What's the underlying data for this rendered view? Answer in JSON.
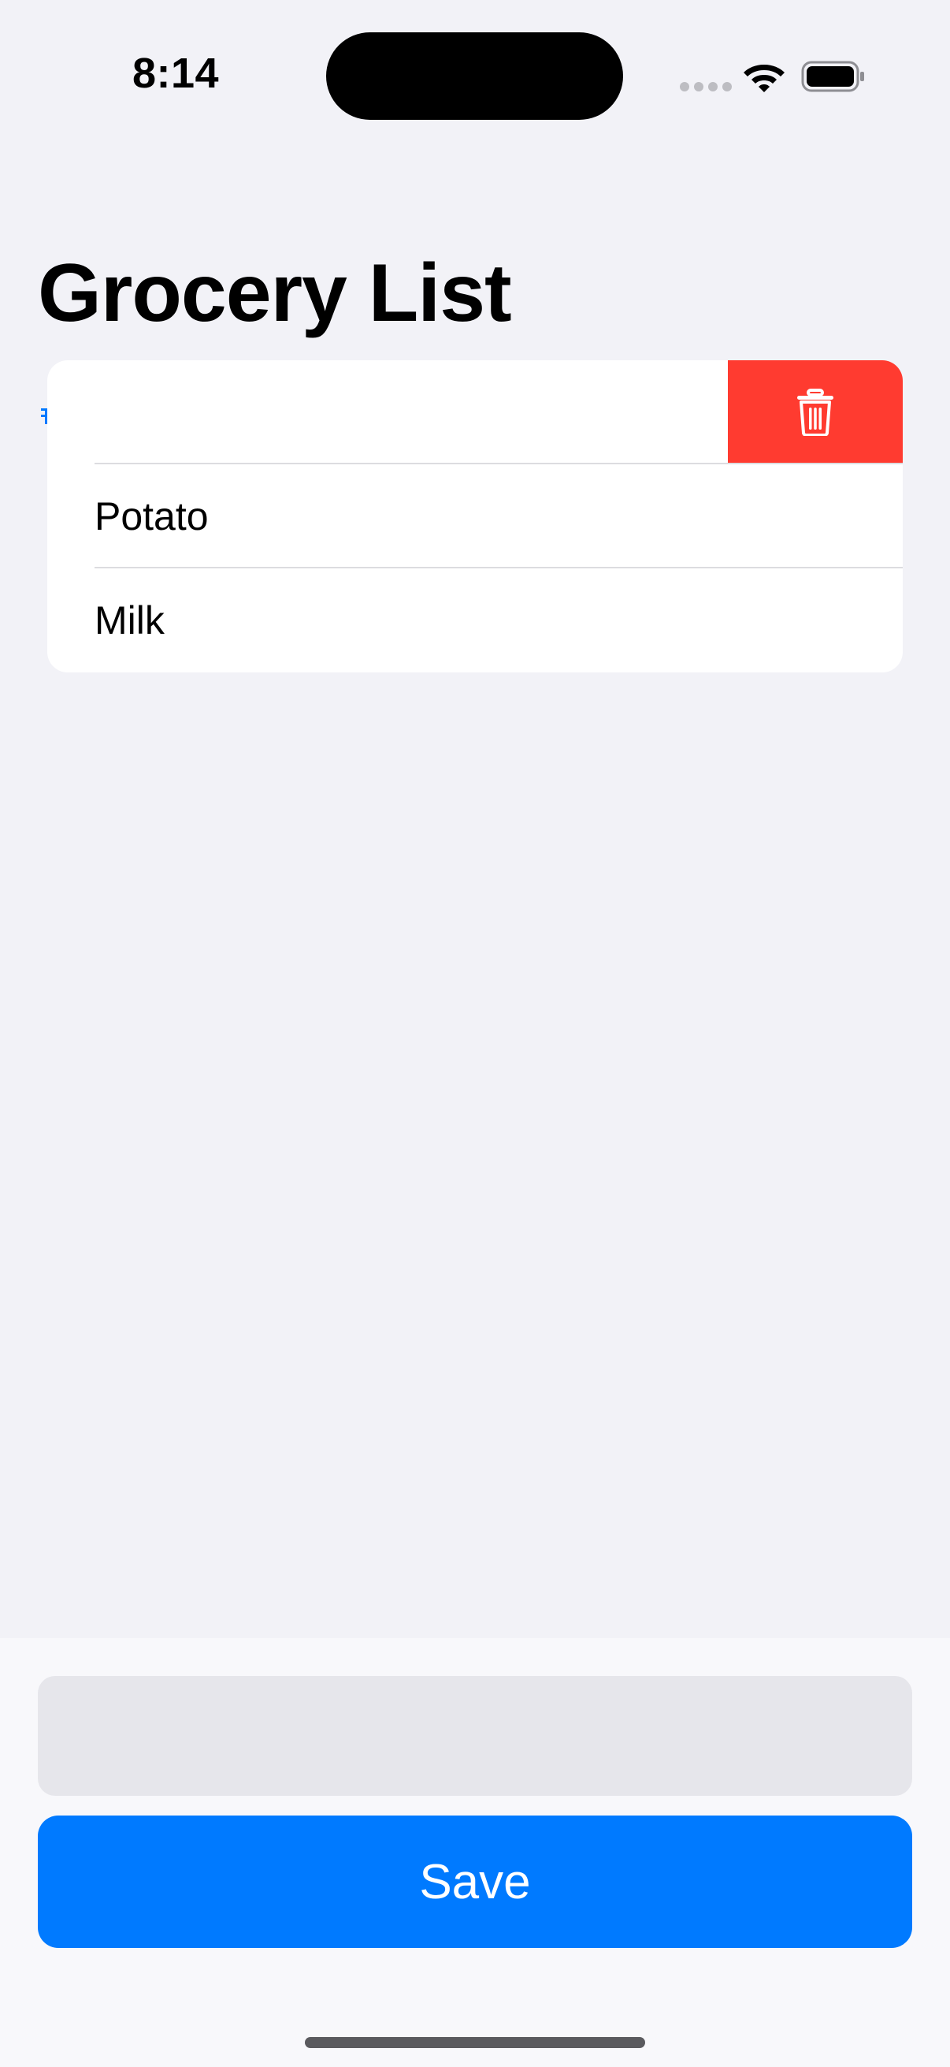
{
  "status_bar": {
    "time": "8:14"
  },
  "header": {
    "title": "Grocery List"
  },
  "list": {
    "items": [
      {
        "label": ""
      },
      {
        "label": "Potato"
      },
      {
        "label": "Milk"
      }
    ],
    "swipe_action": {
      "icon": "trash-icon",
      "color": "#ff3b30"
    }
  },
  "input": {
    "value": "",
    "placeholder": ""
  },
  "save_button": {
    "label": "Save",
    "color": "#007aff"
  },
  "colors": {
    "background": "#f2f2f7",
    "accent": "#007aff",
    "destructive": "#ff3b30"
  }
}
